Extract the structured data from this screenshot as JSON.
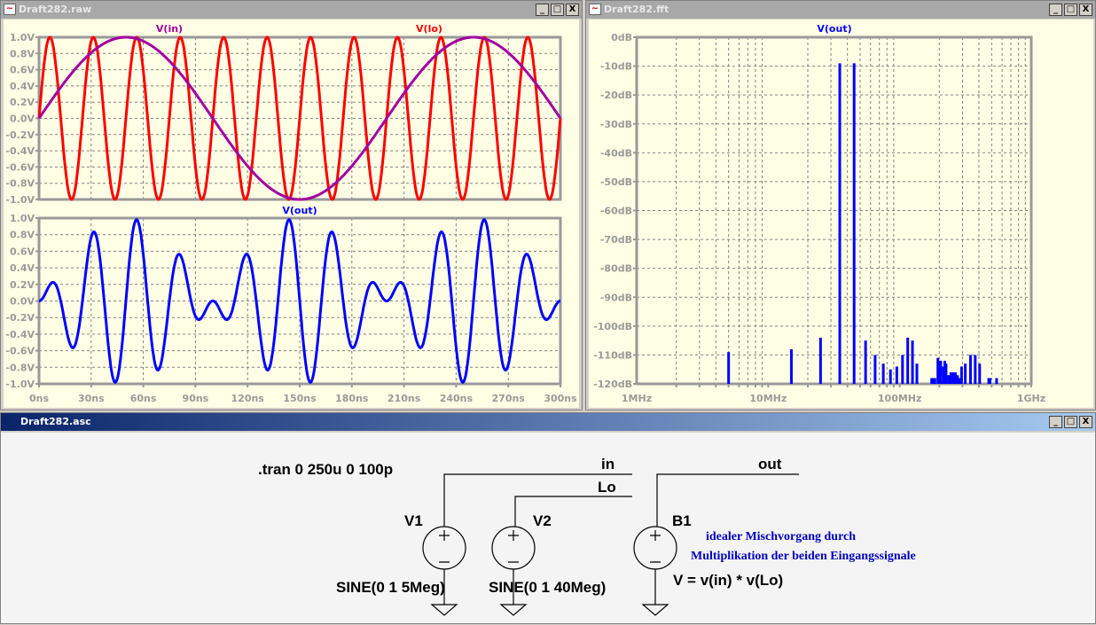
{
  "windows": {
    "raw": {
      "title": "Draft282.raw"
    },
    "fft": {
      "title": "Draft282.fft"
    },
    "asc": {
      "title": "Draft282.asc"
    }
  },
  "window_buttons": [
    "_",
    "□",
    "X"
  ],
  "colors": {
    "vin": "#a000a0",
    "vlo": "#ff0000",
    "vout": "#0000ff",
    "grid": "#808080",
    "plot_bg": "#ffffe6"
  },
  "chart_data": [
    {
      "type": "line",
      "title": "V(in), V(lo)",
      "series": [
        {
          "name": "V(in)",
          "function": "sin",
          "amplitude": 1,
          "frequency_hz": 5000000.0
        },
        {
          "name": "V(lo)",
          "function": "sin",
          "amplitude": 1,
          "frequency_hz": 40000000.0
        }
      ],
      "xlim": [
        0,
        300
      ],
      "xunit": "ns",
      "ylim": [
        -1,
        1
      ],
      "yticks": [
        "1.0V",
        "0.8V",
        "0.6V",
        "0.4V",
        "0.2V",
        "0.0V",
        "-0.2V",
        "-0.4V",
        "-0.6V",
        "-0.8V",
        "-1.0V"
      ],
      "grid": true
    },
    {
      "type": "line",
      "title": "V(out)",
      "series": [
        {
          "name": "V(out)",
          "function": "V(in)*V(lo)"
        }
      ],
      "xlim": [
        0,
        300
      ],
      "ylim": [
        -1,
        1
      ],
      "yticks": [
        "1.0V",
        "0.8V",
        "0.6V",
        "0.4V",
        "0.2V",
        "0.0V",
        "-0.2V",
        "-0.4V",
        "-0.6V",
        "-0.8V",
        "-1.0V"
      ],
      "xticks": [
        "0ns",
        "30ns",
        "60ns",
        "90ns",
        "120ns",
        "150ns",
        "180ns",
        "210ns",
        "240ns",
        "270ns",
        "300ns"
      ],
      "grid": true
    },
    {
      "type": "bar",
      "title": "V(out)",
      "xscale": "log",
      "xlim_hz": [
        1000000.0,
        1000000000.0
      ],
      "ylim": [
        -120,
        0
      ],
      "xticks": [
        "1MHz",
        "10MHz",
        "100MHz",
        "1GHz"
      ],
      "yticks": [
        "0dB",
        "-10dB",
        "-20dB",
        "-30dB",
        "-40dB",
        "-50dB",
        "-60dB",
        "-70dB",
        "-80dB",
        "-90dB",
        "-100dB",
        "-110dB",
        "-120dB"
      ],
      "freq_mhz": [
        5,
        15,
        25,
        35,
        45,
        55,
        65,
        75,
        85,
        95,
        105,
        115,
        125,
        135,
        175,
        180,
        185,
        195,
        200,
        205,
        215,
        220,
        225,
        235,
        245,
        255,
        265,
        275,
        285,
        295,
        315,
        345,
        375,
        405,
        475,
        485,
        545
      ],
      "level_db": [
        -109,
        -108,
        -104,
        -9,
        -9,
        -105,
        -110,
        -113,
        -115,
        -114,
        -110,
        -104,
        -105,
        -113,
        -118,
        -118,
        -118,
        -111,
        -112,
        -112,
        -114,
        -112,
        -113,
        -117,
        -116,
        -116,
        -116,
        -117,
        -118,
        -114,
        -113,
        -110,
        -110,
        -113,
        -118,
        -118,
        -118
      ]
    }
  ],
  "schematic": {
    "directive": ".tran 0 250u 0 100p",
    "nets": [
      "in",
      "Lo",
      "out"
    ],
    "v1": {
      "name": "V1",
      "value": "SINE(0 1 5Meg)"
    },
    "v2": {
      "name": "V2",
      "value": "SINE(0 1 40Meg)"
    },
    "b1": {
      "name": "B1",
      "value": "V = v(in) * v(Lo)"
    },
    "note": [
      "idealer Mischvorgang durch",
      "Multiplikation der beiden Eingangssignale"
    ]
  }
}
